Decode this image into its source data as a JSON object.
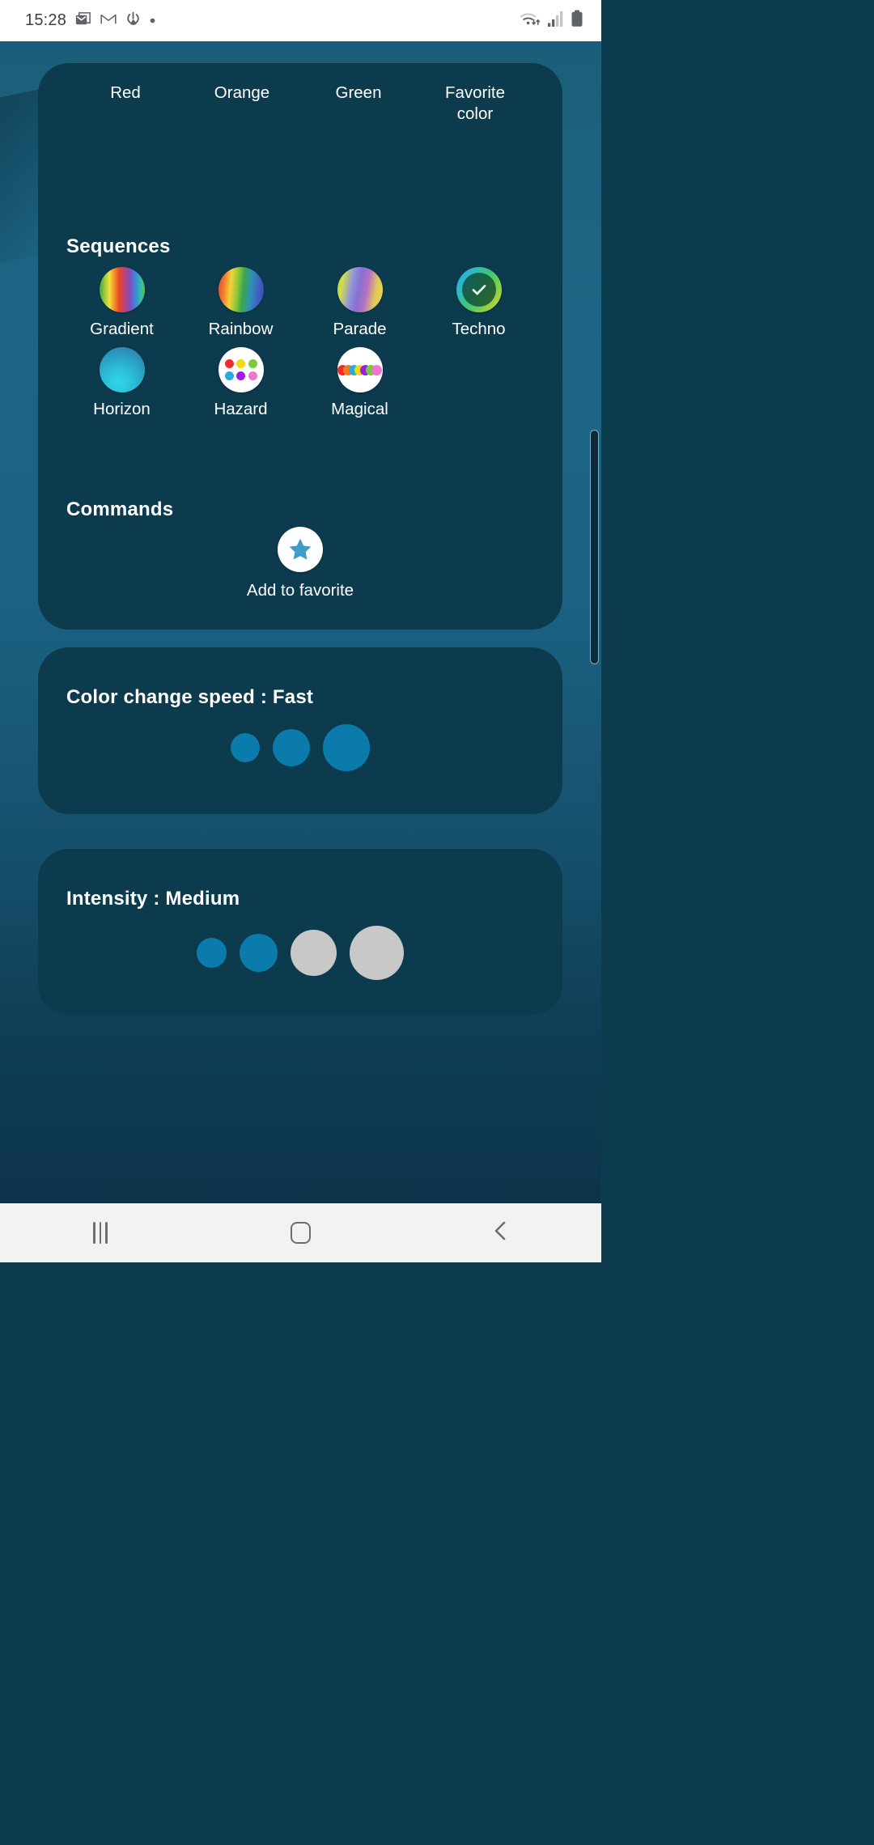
{
  "status_bar": {
    "time": "15:28",
    "left_icons": [
      "message-icon",
      "gmail-icon",
      "power-icon",
      "dot-icon"
    ],
    "right_icons": [
      "wifi-icon",
      "signal-icon",
      "battery-icon"
    ]
  },
  "colors_row": {
    "items": [
      {
        "label": "Red",
        "name": "color-chip-red"
      },
      {
        "label": "Orange",
        "name": "color-chip-orange"
      },
      {
        "label": "Green",
        "name": "color-chip-green"
      },
      {
        "label": "Favorite\ncolor",
        "name": "color-chip-favorite"
      }
    ]
  },
  "sequences": {
    "title": "Sequences",
    "items": [
      {
        "label": "Gradient",
        "icon": "gradient-swatch-icon",
        "selected": false
      },
      {
        "label": "Rainbow",
        "icon": "rainbow-swatch-icon",
        "selected": false
      },
      {
        "label": "Parade",
        "icon": "parade-swatch-icon",
        "selected": false
      },
      {
        "label": "Techno",
        "icon": "techno-swatch-icon",
        "selected": true
      },
      {
        "label": "Horizon",
        "icon": "horizon-swatch-icon",
        "selected": false
      },
      {
        "label": "Hazard",
        "icon": "hazard-swatch-icon",
        "selected": false
      },
      {
        "label": "Magical",
        "icon": "magical-swatch-icon",
        "selected": false
      }
    ],
    "hazard_dot_colors": [
      "#ee2d2d",
      "#f2d817",
      "#7ac943",
      "#29abe2",
      "#9b1ee8",
      "#f472d0"
    ],
    "magical_dot_colors": [
      "#ee2d2d",
      "#f07c1e",
      "#f2d817",
      "#29abe2",
      "#9b1ee8",
      "#7ac943",
      "#f472d0"
    ]
  },
  "commands": {
    "title": "Commands",
    "items": [
      {
        "label": "Add to favorite",
        "icon": "star-icon"
      }
    ]
  },
  "speed_card": {
    "title": "Color change speed : Fast",
    "value": "Fast",
    "active_color": "#0b7bab",
    "inactive_color": "#c8c8c8",
    "levels": [
      {
        "size": 36,
        "active": true
      },
      {
        "size": 46,
        "active": true
      },
      {
        "size": 58,
        "active": true
      }
    ]
  },
  "intensity_card": {
    "title": "Intensity : Medium",
    "value": "Medium",
    "active_color": "#0b7bab",
    "inactive_color": "#c8c8c8",
    "levels": [
      {
        "size": 37,
        "active": true
      },
      {
        "size": 47,
        "active": true
      },
      {
        "size": 57,
        "active": false
      },
      {
        "size": 67,
        "active": false
      }
    ]
  },
  "nav_bar": {
    "buttons": [
      {
        "name": "recents-button",
        "icon": "recents-icon"
      },
      {
        "name": "home-button",
        "icon": "home-icon"
      },
      {
        "name": "back-button",
        "icon": "back-chevron-icon"
      }
    ]
  },
  "theme": {
    "card_bg": "#0c3b4e",
    "page_bg_top": "#1b5e79",
    "page_bg_bottom": "#0b3145",
    "text": "#ffffff",
    "star_blue": "#3f9dc8"
  }
}
